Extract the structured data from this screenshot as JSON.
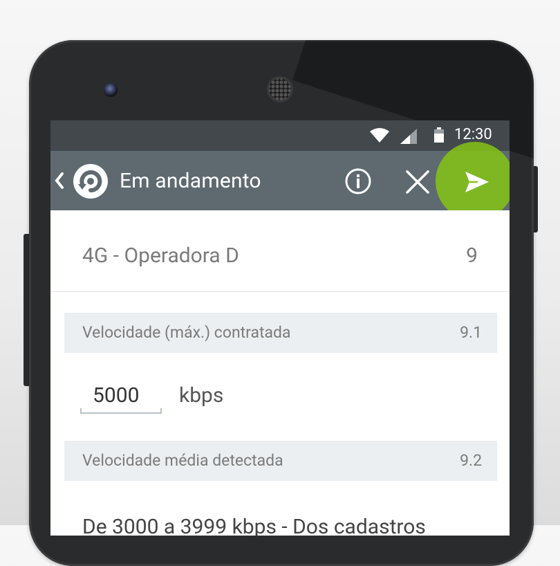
{
  "status_bar": {
    "time": "12:30",
    "icons": [
      "wifi-icon",
      "cell-signal-icon",
      "battery-icon"
    ]
  },
  "app_bar": {
    "back_icon": "chevron-left-icon",
    "logo_icon": "app-logo-icon",
    "title": "Em andamento",
    "actions": [
      "info-icon",
      "close-icon",
      "send-icon"
    ],
    "highlight_color": "#84c414",
    "background_color": "#5e6a70"
  },
  "header_row": {
    "label": "4G - Operadora D",
    "number": "9"
  },
  "sections": [
    {
      "label": "Velocidade (máx.) contratada",
      "number": "9.1"
    },
    {
      "label": "Velocidade média detectada",
      "number": "9.2"
    }
  ],
  "speed_field": {
    "value": "5000",
    "unit": "kbps"
  },
  "partial_text": "De 3000 a 3999 kbps - Dos cadastros"
}
